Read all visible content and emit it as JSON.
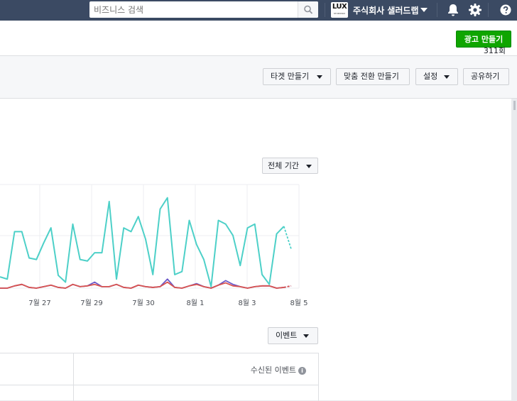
{
  "topbar": {
    "search_placeholder": "비즈니스 검색",
    "business_name": "주식회사 샐러드랩",
    "logo_text": "LUX",
    "logo_subtext": "STUDIOSIX"
  },
  "header": {
    "create_ad_label": "광고 만들기"
  },
  "toolbar": {
    "target_label": "타겟 만들기",
    "custom_conversion_label": "맞춤 전환 만들기",
    "settings_label": "설정",
    "share_label": "공유하기"
  },
  "chart_controls": {
    "period_label": "전체 기간"
  },
  "chart_data": {
    "type": "line",
    "x_tick_labels": [
      "7월 27",
      "7월 29",
      "7월 30",
      "8월 1",
      "8월 3",
      "8월 5"
    ],
    "series": [
      {
        "color": "#4dd0c8",
        "values": [
          15,
          12,
          75,
          75,
          40,
          38,
          60,
          80,
          17,
          8,
          85,
          38,
          36,
          47,
          47,
          115,
          12,
          80,
          75,
          95,
          65,
          18,
          105,
          120,
          18,
          22,
          90,
          58,
          38,
          2,
          90,
          85,
          70,
          30,
          80,
          85,
          18,
          5,
          72,
          82,
          52
        ]
      },
      {
        "color": "#6b58c8",
        "values": [
          0,
          0,
          3,
          5,
          1,
          0,
          2,
          4,
          1,
          0,
          5,
          2,
          3,
          8,
          2,
          2,
          5,
          1,
          0,
          4,
          2,
          1,
          2,
          12,
          1,
          0,
          3,
          6,
          2,
          0,
          4,
          10,
          5,
          2,
          0,
          2,
          3,
          3,
          0,
          1,
          3
        ]
      },
      {
        "color": "#d9534f",
        "values": [
          0,
          0,
          3,
          5,
          1,
          0,
          2,
          4,
          1,
          0,
          5,
          2,
          3,
          5,
          2,
          2,
          5,
          1,
          0,
          4,
          2,
          1,
          2,
          8,
          1,
          0,
          3,
          5,
          2,
          0,
          4,
          7,
          3,
          2,
          0,
          2,
          3,
          3,
          0,
          1,
          3
        ]
      }
    ]
  },
  "events": {
    "button_label": "이벤트"
  },
  "table": {
    "columns": [
      "수신된 이벤트"
    ],
    "info_glyph": "i",
    "first_value": "311회"
  }
}
